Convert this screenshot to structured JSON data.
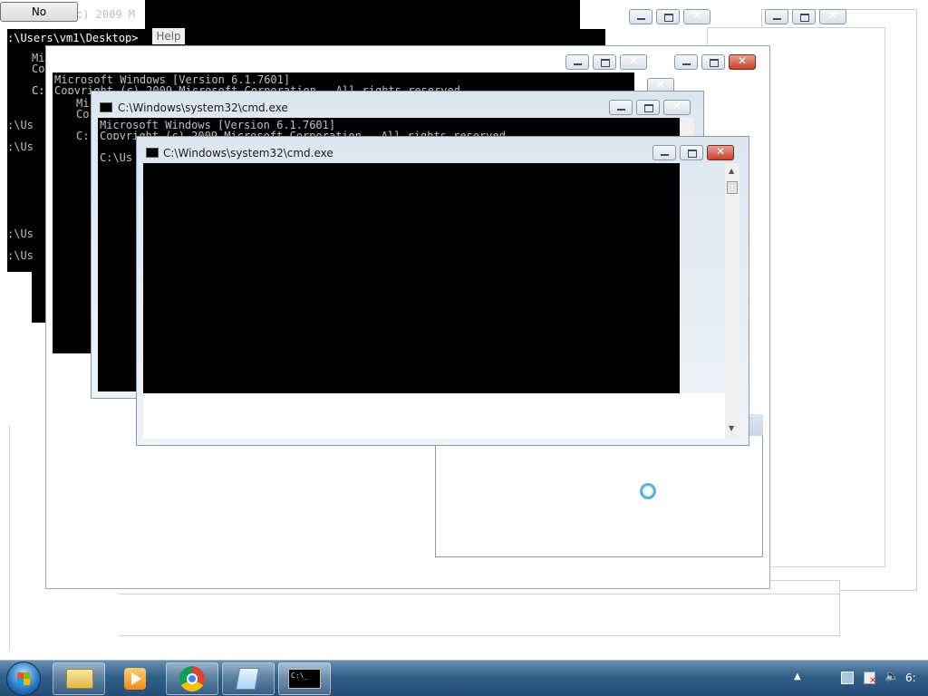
{
  "dialog": {
    "no_button": "No",
    "help_menu": "Help"
  },
  "back_console": {
    "path_line": ":\\Users\\vm1\\Desktop>",
    "top_fragment": "c) 2009 M",
    "lines": [
      "Mi",
      "Co",
      "C:",
      ":\\Us  rs",
      ":\\Us  rs",
      ":\\Us  rs",
      ":\\Us  rs"
    ]
  },
  "mid_console": {
    "line1": "Microsoft Windows [Version 6.1.7601]",
    "line2": "Copyright (c) 2009 Microsoft Corporation.  All rights reserved.",
    "line3": "C:",
    "line4": "Mi",
    "line5": "Co"
  },
  "cmd_window_back": {
    "title": "C:\\Windows\\system32\\cmd.exe",
    "line1": "Microsoft Windows [Version 6.1.7601]",
    "line2": "Copyright (c) 2009 Microsoft Corporation.  All rights reserved.",
    "line3": "C:\\Us",
    "line4": "C:"
  },
  "cmd_window_front": {
    "title": "C:\\Windows\\system32\\cmd.exe"
  },
  "taskbar": {
    "items": [
      "start-orb",
      "file-explorer",
      "media-player",
      "chrome",
      "notepad",
      "command-prompt"
    ],
    "cmd_icon_text": "C:\\_",
    "clock": "6:"
  },
  "colors": {
    "taskbar": "#2f5f88",
    "close_button": "#c8412a"
  }
}
